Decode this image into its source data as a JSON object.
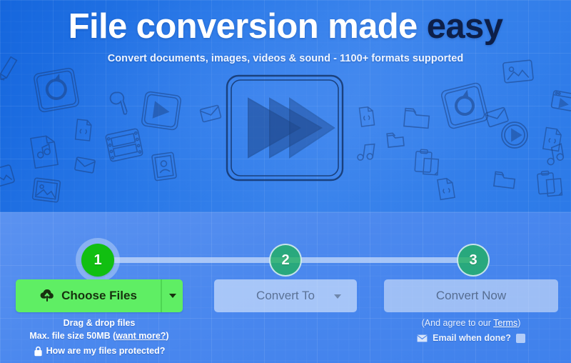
{
  "hero": {
    "title_main": "File conversion made ",
    "title_accent": "easy",
    "subtitle": "Convert documents, images, videos & sound - 1100+ formats supported",
    "art_icon": "sketch-fast-forward-icon",
    "background_icons": [
      "pencil-icon",
      "refresh-square-icon",
      "wrench-icon",
      "play-square-icon",
      "envelope-icon",
      "mp3-file-icon",
      "code-file-icon",
      "film-strip-icon",
      "contact-card-icon",
      "image-frame-icon",
      "folder-icon",
      "clipboard-icon",
      "music-note-icon",
      "play-circle-icon",
      "image-photo-icon",
      "video-file-icon"
    ]
  },
  "steps": [
    {
      "number": "1",
      "state": "active"
    },
    {
      "number": "2",
      "state": "inactive"
    },
    {
      "number": "3",
      "state": "inactive"
    }
  ],
  "actions": {
    "choose_files_label": "Choose Files",
    "choose_files_icon": "cloud-upload-icon",
    "choose_files_caret_icon": "chevron-down-icon",
    "convert_to_label": "Convert To",
    "convert_to_caret_icon": "chevron-down-icon",
    "convert_now_label": "Convert Now"
  },
  "left_notes": {
    "drag_drop": "Drag & drop files",
    "max_size_prefix": "Max. file size 50MB (",
    "max_size_link": "want more?",
    "max_size_suffix": ")",
    "protected_link": "How are my files protected?",
    "lock_icon": "lock-icon"
  },
  "right_notes": {
    "terms_prefix": "(And agree to our ",
    "terms_link": "Terms",
    "terms_suffix": ")",
    "email_label": "Email when done?",
    "email_icon": "envelope-icon",
    "email_checked": false
  },
  "colors": {
    "hero_blue_dark": "#1566dd",
    "hero_blue_light": "#3b84ec",
    "lower_blue": "#4b88ee",
    "green_button": "#5fee64",
    "step_active_green": "#11bf11",
    "step_inactive_green": "#20b060",
    "accent_navy": "#0d1f49",
    "disabled_button": "#dee9fc",
    "disabled_text": "#5b7296"
  }
}
